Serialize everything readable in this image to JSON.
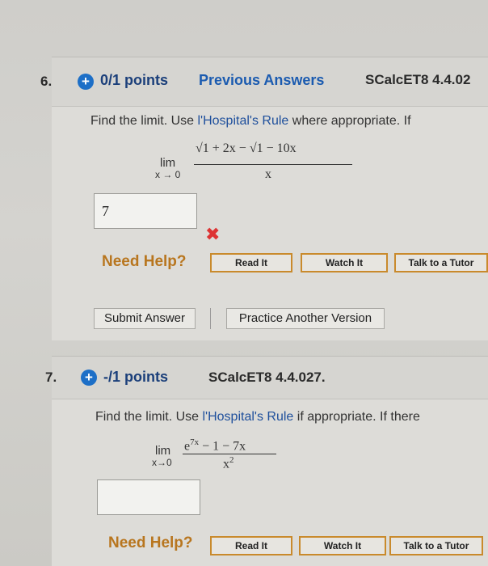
{
  "q6": {
    "number": "6.",
    "points": "0/1 points",
    "previous_answers": "Previous Answers",
    "code": "SCalcET8 4.4.02",
    "prompt_start": "Find the limit. Use ",
    "prompt_rule": "l'Hospital's Rule",
    "prompt_end": " where appropriate. If",
    "lim": "lim",
    "lim_sub": "x → 0",
    "numerator": "√1 + 2x − √1 − 10x",
    "denominator": "x",
    "answer_value": "7",
    "wrong_mark": "✖",
    "need_help": "Need Help?",
    "read_it": "Read It",
    "watch_it": "Watch It",
    "talk_tutor": "Talk to a Tutor",
    "submit": "Submit Answer",
    "practice": "Practice Another Version"
  },
  "q7": {
    "number": "7.",
    "points": "-/1 points",
    "code": "SCalcET8 4.4.027.",
    "prompt_start": "Find the limit. Use ",
    "prompt_rule": "l'Hospital's Rule",
    "prompt_end": " if appropriate. If there",
    "lim": "lim",
    "lim_sub": "x→0",
    "numerator": "e^7x − 1 − 7x",
    "numerator_base": "e",
    "numerator_exp": "7x",
    "numerator_rest": " − 1 − 7x",
    "denominator_base": "x",
    "denominator_exp": "2",
    "need_help": "Need Help?",
    "read_it": "Read It",
    "watch_it": "Watch It",
    "talk_tutor": "Talk to a Tutor"
  },
  "colors": {
    "accent_blue": "#1d6fc7",
    "help_orange": "#b8761f",
    "wrong_red": "#d33"
  }
}
